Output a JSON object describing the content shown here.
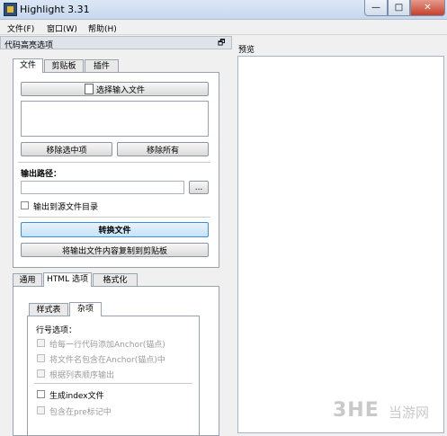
{
  "window": {
    "title": "Highlight 3.31",
    "min": "—",
    "max": "□",
    "close": "✕"
  },
  "menu": [
    "文件(F)",
    "窗口(W)",
    "帮助(H)"
  ],
  "panel": {
    "title": "代码高亮选项",
    "pin": "🗗"
  },
  "preview": {
    "label": "预览"
  },
  "top_tabs": [
    "文件",
    "剪贴板",
    "插件"
  ],
  "file_tab": {
    "select_input": "选择输入文件",
    "remove_selected": "移除选中项",
    "remove_all": "移除所有",
    "output_path_label": "输出路径：",
    "browse": "...",
    "output_to_source": "输出到源文件目录",
    "convert": "转换文件",
    "copy_to_clipboard": "将输出文件内容复制到剪贴板"
  },
  "bottom_tabs": [
    "通用",
    "HTML 选项",
    "格式化"
  ],
  "html_tabs": [
    "样式表",
    "杂项"
  ],
  "misc": {
    "line_options_label": "行号选项：",
    "options": [
      {
        "label": "给每一行代码添加Anchor(锚点)",
        "disabled": true,
        "checked": false
      },
      {
        "label": "将文件名包含在Anchor(锚点)中",
        "disabled": true,
        "checked": false
      },
      {
        "label": "根据列表顺序输出",
        "disabled": true,
        "checked": false
      }
    ],
    "generate_index": "生成index文件",
    "include_pre": "包含在pre标记中"
  },
  "watermark": {
    "main": "3HE",
    "text": "当游网"
  }
}
